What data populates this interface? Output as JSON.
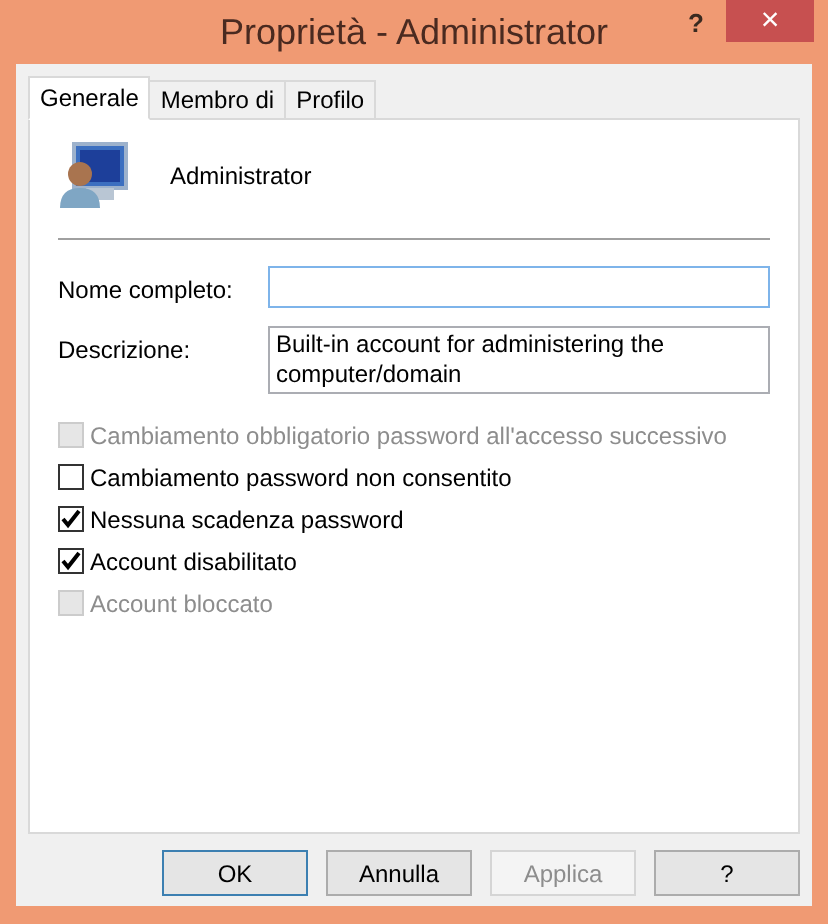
{
  "window": {
    "title": "Proprietà - Administrator",
    "help": "?",
    "close": "×"
  },
  "tabs": [
    {
      "label": "Generale",
      "selected": true
    },
    {
      "label": "Membro di",
      "selected": false
    },
    {
      "label": "Profilo",
      "selected": false
    }
  ],
  "account": {
    "name": "Administrator"
  },
  "fields": [
    {
      "label": "Nome completo:",
      "kind": "single"
    },
    {
      "label": "Descrizione:",
      "value": "Built-in account for administering the computer/domain",
      "kind": "multi"
    }
  ],
  "options": [
    {
      "label": "Cambiamento obbligatorio password all'accesso successivo",
      "checked": false,
      "disabled": true
    },
    {
      "label": "Cambiamento password non consentito",
      "checked": false,
      "disabled": false
    },
    {
      "label": "Nessuna scadenza password",
      "checked": true,
      "disabled": false
    },
    {
      "label": "Account disabilitato",
      "checked": true,
      "disabled": false
    },
    {
      "label": "Account bloccato",
      "checked": false,
      "disabled": true
    }
  ],
  "buttons": [
    {
      "label": "OK",
      "disabled": false,
      "default": true
    },
    {
      "label": "Annulla",
      "disabled": false,
      "default": false
    },
    {
      "label": "Applica",
      "disabled": true,
      "default": false
    },
    {
      "label": "?",
      "disabled": false,
      "default": false
    }
  ]
}
